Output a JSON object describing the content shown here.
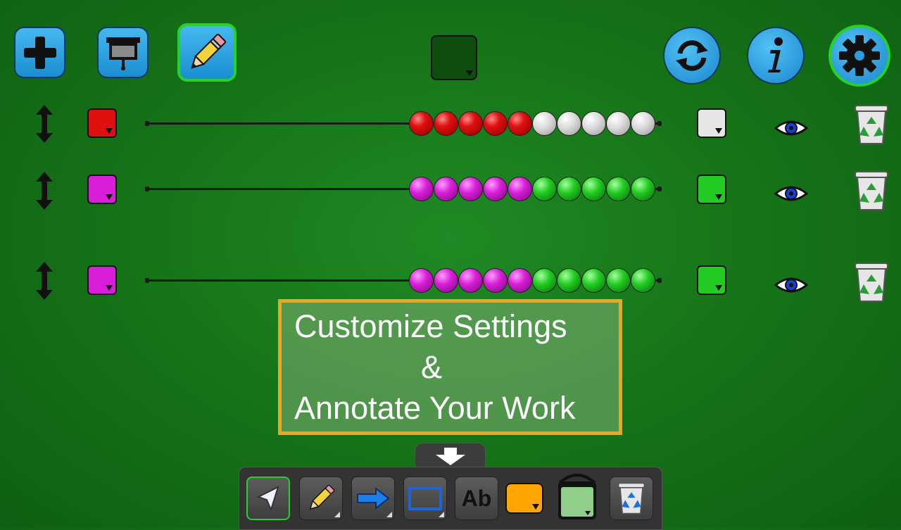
{
  "toolbar_top": {
    "add_icon": "plus-icon",
    "present_icon": "projector-screen-icon",
    "pencil_icon": "pencil-icon",
    "reset_icon": "refresh-icon",
    "info_icon": "info-icon",
    "settings_icon": "gear-icon",
    "background_color": "#0d4d0d"
  },
  "rows": [
    {
      "left_color": "#e01010",
      "right_color": "#e6e6e6",
      "left_beads": 5,
      "right_beads": 5,
      "left_bead_kind": "red",
      "right_bead_kind": "grey"
    },
    {
      "left_color": "#d81ed8",
      "right_color": "#22cc22",
      "left_beads": 5,
      "right_beads": 5,
      "left_bead_kind": "magenta",
      "right_bead_kind": "green"
    },
    {
      "left_color": "#d81ed8",
      "right_color": "#22cc22",
      "left_beads": 5,
      "right_beads": 5,
      "left_bead_kind": "magenta",
      "right_bead_kind": "green"
    }
  ],
  "callout": {
    "line1": "Customize Settings",
    "line2": "&",
    "line3": "Annotate Your Work",
    "border_color": "#f5a31a"
  },
  "bottom_toolbar": {
    "tools": [
      "pointer-arrow-icon",
      "pencil-icon",
      "arrow-right-icon",
      "rectangle-icon",
      "text-tool",
      "color-swatch",
      "fill-bucket-icon",
      "recycle-bin-icon"
    ],
    "text_tool_label": "Ab",
    "pen_color": "#ffa500",
    "fill_color": "#8fcf8a",
    "toggle_icon": "arrow-down-icon"
  }
}
